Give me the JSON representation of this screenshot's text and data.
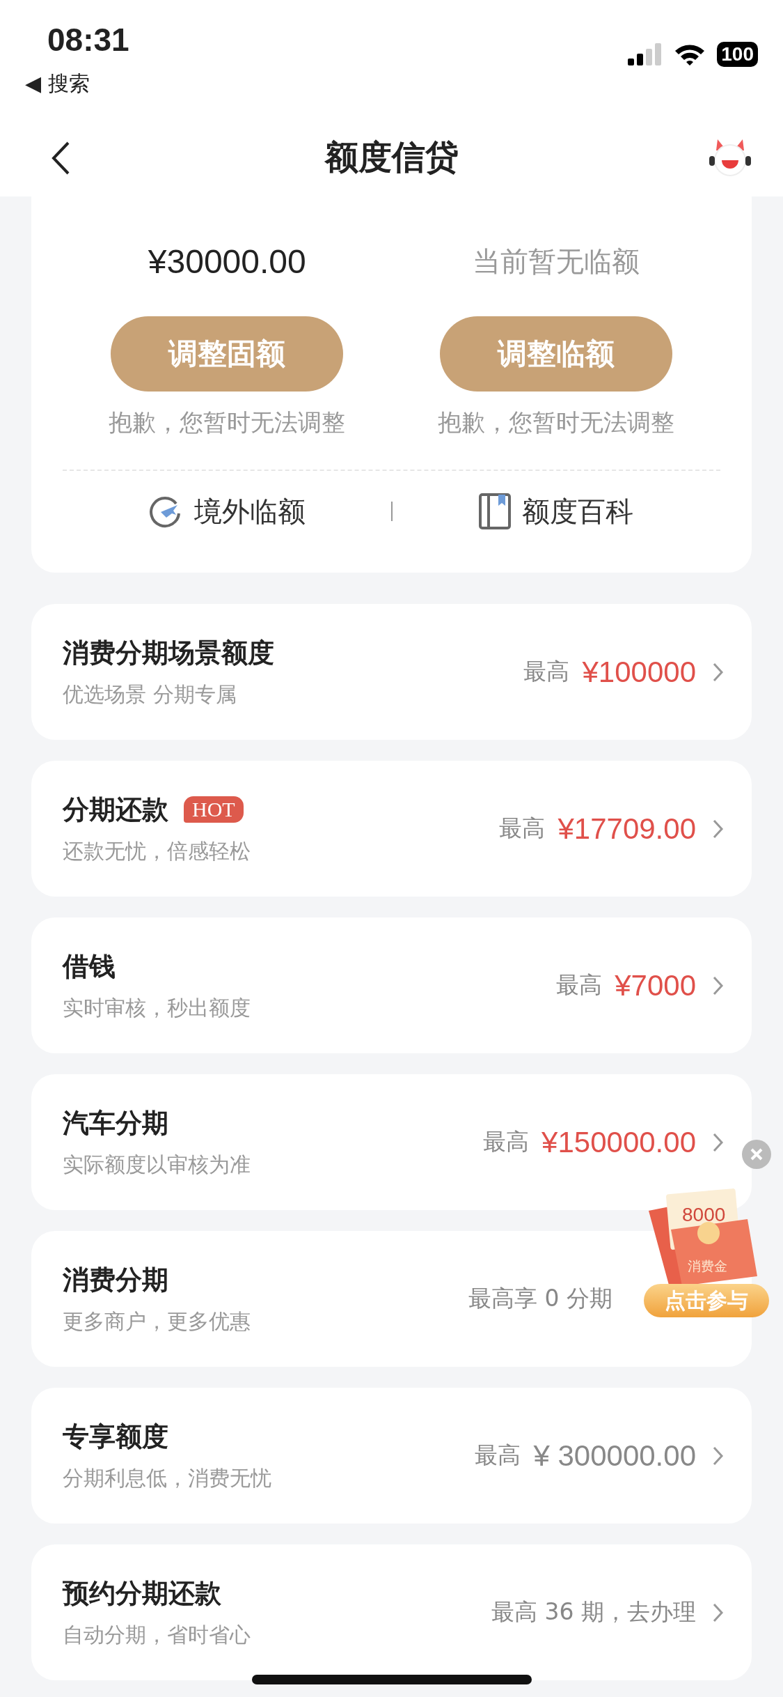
{
  "status_bar": {
    "time": "08:31",
    "back_app": "◀ 搜索",
    "battery": "100"
  },
  "nav": {
    "title": "额度信贷"
  },
  "limit_card": {
    "columns": [
      {
        "amount": "¥30000.00",
        "has_amount": true,
        "button": "调整固额",
        "note": "抱歉，您暂时无法调整"
      },
      {
        "amount": "当前暂无临额",
        "has_amount": false,
        "button": "调整临额",
        "note": "抱歉，您暂时无法调整"
      }
    ],
    "links": [
      {
        "kind": "plane",
        "label": "境外临额"
      },
      {
        "kind": "book",
        "label": "额度百科"
      }
    ]
  },
  "rows": [
    {
      "title": "消费分期场景额度",
      "subtitle": "优选场景 分期专属",
      "prefix": "最高",
      "amount": "¥100000",
      "highlight": true,
      "chevron": true
    },
    {
      "title": "分期还款",
      "badge": "HOT",
      "subtitle": "还款无忧，倍感轻松",
      "prefix": "最高",
      "amount": "¥17709.00",
      "highlight": true,
      "chevron": true
    },
    {
      "title": "借钱",
      "subtitle": "实时审核，秒出额度",
      "prefix": "最高",
      "amount": "¥7000",
      "highlight": true,
      "chevron": true
    },
    {
      "title": "汽车分期",
      "subtitle": "实际额度以审核为准",
      "prefix": "最高",
      "amount": "¥150000.00",
      "highlight": true,
      "chevron": true
    },
    {
      "title": "消费分期",
      "subtitle": "更多商户，更多优惠",
      "prefix": "最高享 0 分期",
      "chevron": false
    },
    {
      "title": "专享额度",
      "subtitle": "分期利息低，消费无忧",
      "prefix": "最高",
      "amount": "¥ 300000.00",
      "highlight": false,
      "chevron": true
    },
    {
      "title": "预约分期还款",
      "subtitle": "自动分期，省时省心",
      "prefix": "最高 36 期，去办理",
      "chevron": true
    }
  ],
  "promo": {
    "amount": "8000",
    "label": "消费金",
    "button": "点击参与"
  }
}
